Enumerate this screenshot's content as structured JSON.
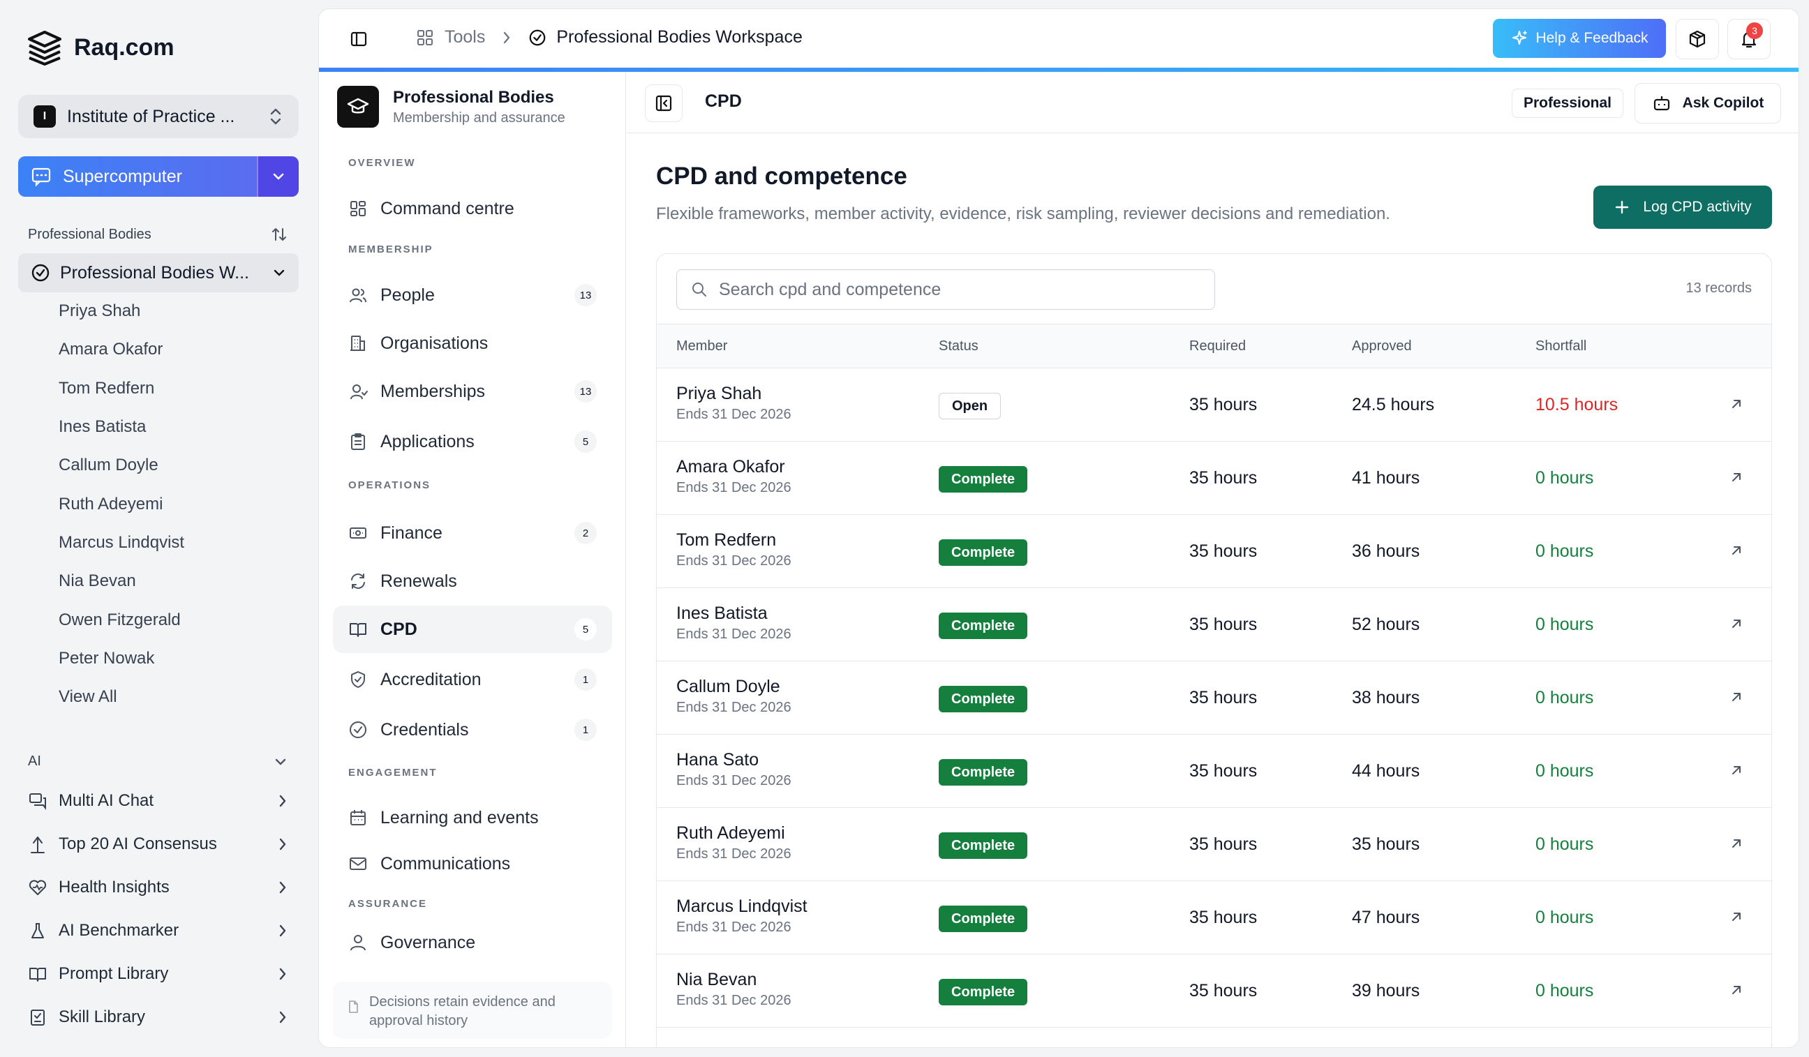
{
  "app": {
    "brand": "Raq.com",
    "org_name": "Institute of Practice ...",
    "org_initial": "I",
    "supercomputer_label": "Supercomputer"
  },
  "sidebar": {
    "section_title": "Professional Bodies",
    "workspace_item": "Professional Bodies W...",
    "members": [
      "Priya Shah",
      "Amara Okafor",
      "Tom Redfern",
      "Ines Batista",
      "Callum Doyle",
      "Ruth Adeyemi",
      "Marcus Lindqvist",
      "Nia Bevan",
      "Owen Fitzgerald",
      "Peter Nowak",
      "View All"
    ],
    "ai_section": "AI",
    "ai_items": [
      {
        "label": "Multi AI Chat",
        "icon": "chat-icon"
      },
      {
        "label": "Top 20 AI Consensus",
        "icon": "consensus-icon"
      },
      {
        "label": "Health Insights",
        "icon": "heart-icon"
      },
      {
        "label": "AI Benchmarker",
        "icon": "flask-icon"
      },
      {
        "label": "Prompt Library",
        "icon": "book-icon"
      },
      {
        "label": "Skill Library",
        "icon": "clipboard-icon"
      }
    ]
  },
  "topbar": {
    "breadcrumb_tools": "Tools",
    "breadcrumb_current": "Professional Bodies Workspace",
    "help_label": "Help & Feedback",
    "notification_count": "3"
  },
  "module": {
    "title": "Professional Bodies",
    "subtitle": "Membership and assurance",
    "sections": {
      "overview": "OVERVIEW",
      "membership": "MEMBERSHIP",
      "operations": "OPERATIONS",
      "engagement": "ENGAGEMENT",
      "assurance": "ASSURANCE"
    },
    "items": {
      "command": {
        "label": "Command centre"
      },
      "people": {
        "label": "People",
        "count": "13"
      },
      "organisations": {
        "label": "Organisations"
      },
      "memberships": {
        "label": "Memberships",
        "count": "13"
      },
      "applications": {
        "label": "Applications",
        "count": "5"
      },
      "finance": {
        "label": "Finance",
        "count": "2"
      },
      "renewals": {
        "label": "Renewals"
      },
      "cpd": {
        "label": "CPD",
        "count": "5"
      },
      "accreditation": {
        "label": "Accreditation",
        "count": "1"
      },
      "credentials": {
        "label": "Credentials",
        "count": "1"
      },
      "learning": {
        "label": "Learning and events"
      },
      "communications": {
        "label": "Communications"
      },
      "governance": {
        "label": "Governance"
      }
    },
    "footer_note": "Decisions retain evidence and approval history"
  },
  "content": {
    "section_name": "CPD",
    "badge": "Professional",
    "copilot_label": "Ask Copilot",
    "title": "CPD and competence",
    "description": "Flexible frameworks, member activity, evidence, risk sampling, reviewer decisions and remediation.",
    "primary_action": "Log CPD activity",
    "search_placeholder": "Search cpd and competence",
    "record_count": "13 records",
    "columns": {
      "member": "Member",
      "status": "Status",
      "required": "Required",
      "approved": "Approved",
      "shortfall": "Shortfall"
    },
    "rows": [
      {
        "name": "Priya Shah",
        "ends": "Ends 31 Dec 2026",
        "status": "Open",
        "required": "35 hours",
        "approved": "24.5 hours",
        "shortfall": "10.5 hours"
      },
      {
        "name": "Amara Okafor",
        "ends": "Ends 31 Dec 2026",
        "status": "Complete",
        "required": "35 hours",
        "approved": "41 hours",
        "shortfall": "0 hours"
      },
      {
        "name": "Tom Redfern",
        "ends": "Ends 31 Dec 2026",
        "status": "Complete",
        "required": "35 hours",
        "approved": "36 hours",
        "shortfall": "0 hours"
      },
      {
        "name": "Ines Batista",
        "ends": "Ends 31 Dec 2026",
        "status": "Complete",
        "required": "35 hours",
        "approved": "52 hours",
        "shortfall": "0 hours"
      },
      {
        "name": "Callum Doyle",
        "ends": "Ends 31 Dec 2026",
        "status": "Complete",
        "required": "35 hours",
        "approved": "38 hours",
        "shortfall": "0 hours"
      },
      {
        "name": "Hana Sato",
        "ends": "Ends 31 Dec 2026",
        "status": "Complete",
        "required": "35 hours",
        "approved": "44 hours",
        "shortfall": "0 hours"
      },
      {
        "name": "Ruth Adeyemi",
        "ends": "Ends 31 Dec 2026",
        "status": "Complete",
        "required": "35 hours",
        "approved": "35 hours",
        "shortfall": "0 hours"
      },
      {
        "name": "Marcus Lindqvist",
        "ends": "Ends 31 Dec 2026",
        "status": "Complete",
        "required": "35 hours",
        "approved": "47 hours",
        "shortfall": "0 hours"
      },
      {
        "name": "Nia Bevan",
        "ends": "Ends 31 Dec 2026",
        "status": "Complete",
        "required": "35 hours",
        "approved": "39 hours",
        "shortfall": "0 hours"
      }
    ]
  },
  "colors": {
    "accent": "#3b82f6",
    "primary_green": "#0f6e63",
    "status_complete": "#15803d",
    "shortfall_red": "#dc2626",
    "shortfall_ok": "#15803d"
  }
}
